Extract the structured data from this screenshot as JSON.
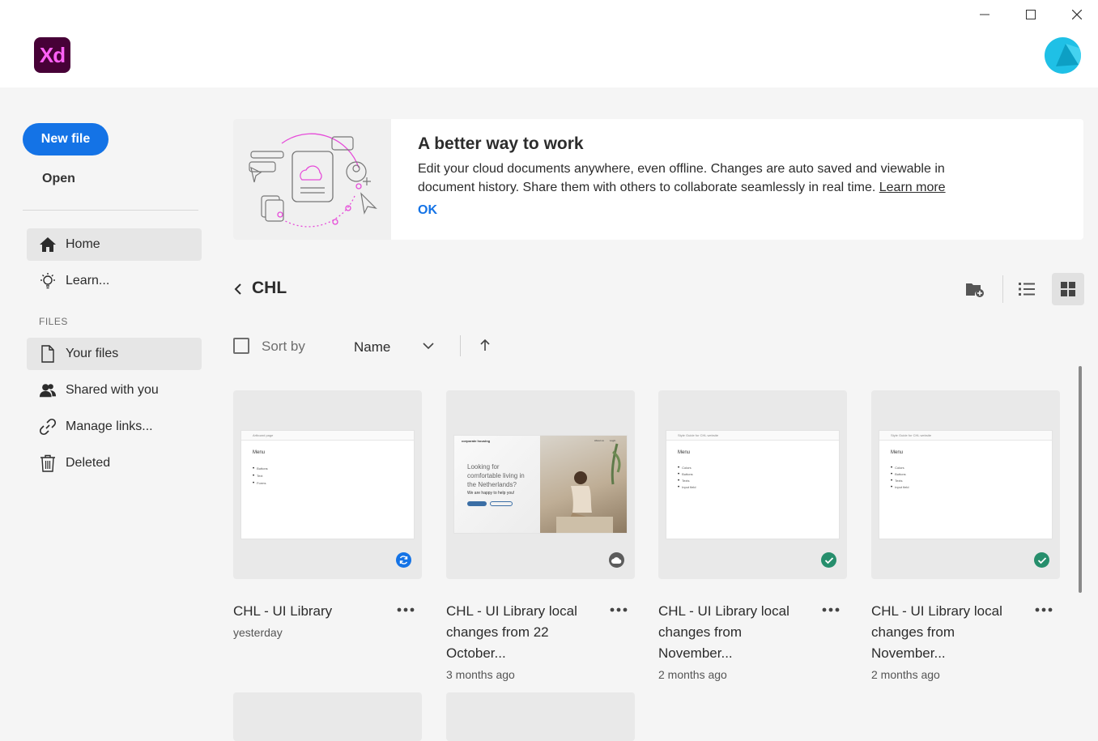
{
  "app": {
    "logo_text": "Xd",
    "brand_color": "#470137",
    "logo_text_color": "#ff61f6",
    "accent_color": "#1473e6"
  },
  "window": {
    "minimize_icon": "minimize-icon",
    "maximize_icon": "maximize-icon",
    "close_icon": "close-icon"
  },
  "sidebar": {
    "new_file_label": "New file",
    "open_label": "Open",
    "nav": [
      {
        "label": "Home",
        "icon": "home-icon",
        "active": true
      },
      {
        "label": "Learn...",
        "icon": "lightbulb-icon",
        "active": false
      }
    ],
    "files_section_label": "FILES",
    "files_nav": [
      {
        "label": "Your files",
        "icon": "document-icon",
        "active": true
      },
      {
        "label": "Shared with you",
        "icon": "people-icon",
        "active": false
      },
      {
        "label": "Manage links...",
        "icon": "link-icon",
        "active": false
      },
      {
        "label": "Deleted",
        "icon": "trash-icon",
        "active": false
      }
    ]
  },
  "banner": {
    "title": "A better way to work",
    "text": "Edit your cloud documents anywhere, even offline. Changes are auto saved and viewable in document history. Share them with others to collaborate seamlessly in real time.",
    "link_label": "Learn more",
    "ok_label": "OK"
  },
  "folder": {
    "title": "CHL",
    "back_icon": "chevron-left-icon",
    "new_folder_icon": "new-folder-icon",
    "list_view_icon": "list-view-icon",
    "grid_view_icon": "grid-view-icon",
    "active_view": "grid"
  },
  "sort": {
    "label": "Sort by",
    "value": "Name",
    "direction": "ascending"
  },
  "files": [
    {
      "name": "CHL - UI Library",
      "modified": "yesterday",
      "status": "syncing"
    },
    {
      "name": "CHL - UI Library local changes from 22 October...",
      "modified": "3 months ago",
      "status": "cloud"
    },
    {
      "name": "CHL - UI Library local changes from November...",
      "modified": "2 months ago",
      "status": "synced"
    },
    {
      "name": "CHL - UI Library local changes from November...",
      "modified": "2 months ago",
      "status": "synced"
    }
  ],
  "previews": {
    "card1": {
      "bar": "Artboard page",
      "menu": "Menu",
      "items": [
        "Buttons",
        "Text",
        "Forms"
      ]
    },
    "card2": {
      "logo": "corporate housing",
      "nav": [
        "About us",
        "Login"
      ],
      "headline": "Looking for comfortable living in the Netherlands?",
      "subline": "We are happy to help you!"
    },
    "card3": {
      "bar": "Style Guide for CHL website",
      "menu": "Menu",
      "items": [
        "Colors",
        "Buttons",
        "Texts",
        "Input field"
      ]
    },
    "card4": {
      "bar": "Style Guide for CHL website",
      "menu": "Menu",
      "items": [
        "Colors",
        "Buttons",
        "Texts",
        "Input field"
      ]
    }
  },
  "status_colors": {
    "syncing": "#1473e6",
    "cloud": "#5c5c5c",
    "synced": "#268e6c"
  }
}
